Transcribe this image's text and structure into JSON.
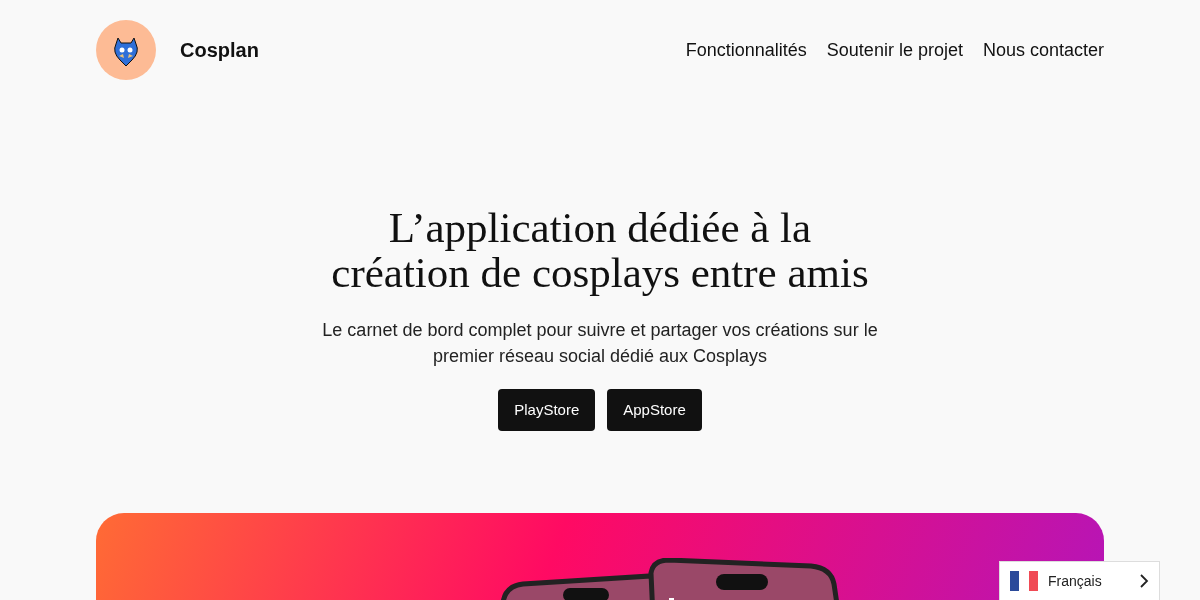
{
  "header": {
    "brand": "Cosplan",
    "nav": [
      "Fonctionnalités",
      "Soutenir le projet",
      "Nous contacter"
    ]
  },
  "hero": {
    "title": "L’application dédiée à la création de cosplays entre amis",
    "subtitle": "Le carnet de bord complet pour suivre et partager vos créations sur le premier réseau social dédié aux Cosplays",
    "buttons": [
      "PlayStore",
      "AppStore"
    ]
  },
  "language_selector": {
    "label": "Français"
  }
}
